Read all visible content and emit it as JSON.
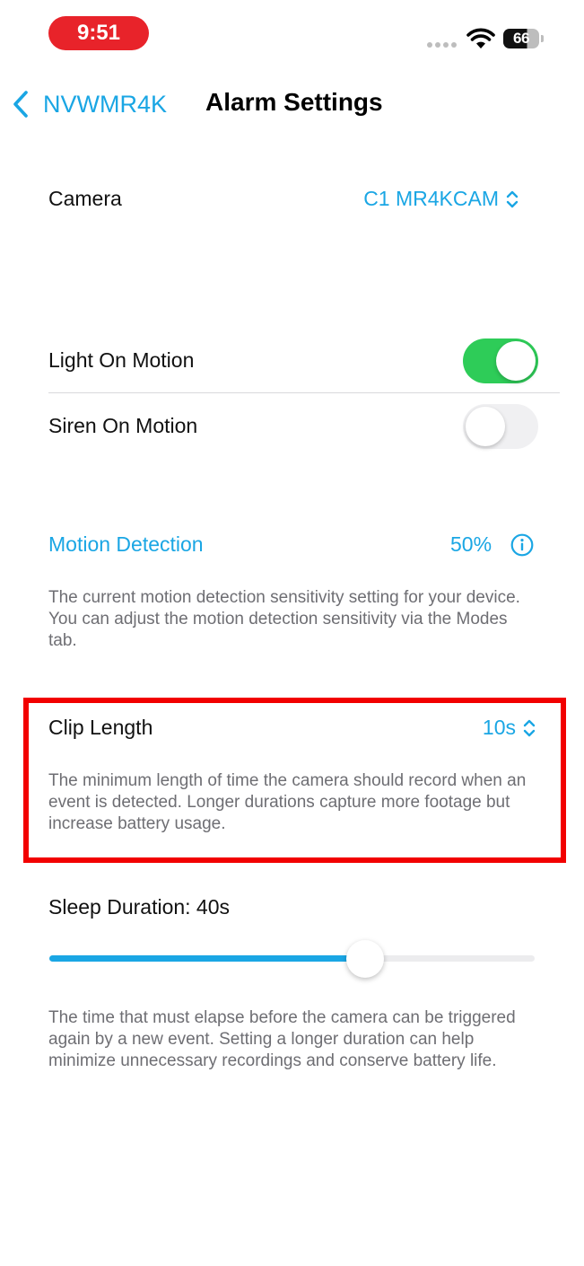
{
  "status_bar": {
    "time": "9:51",
    "battery": "66",
    "battery_level": 0.66,
    "time_pill_color": "#e8232a"
  },
  "nav": {
    "back_label": "NVWMR4K",
    "title": "Alarm Settings"
  },
  "camera": {
    "label": "Camera",
    "value": "C1 MR4KCAM"
  },
  "light_on_motion": {
    "label": "Light On Motion",
    "on": true
  },
  "siren_on_motion": {
    "label": "Siren On Motion",
    "on": false
  },
  "motion_detection": {
    "label": "Motion Detection",
    "value": "50%",
    "description": "The current motion detection sensitivity setting for your device. You can adjust the motion detection sensitivity via the Modes tab."
  },
  "clip_length": {
    "label": "Clip Length",
    "value": "10s",
    "description": "The minimum length of time the camera should record when an event is detected. Longer durations capture more footage but increase battery usage."
  },
  "sleep_duration": {
    "label": "Sleep Duration: 40s",
    "slider_fraction": 0.65,
    "description": "The time that must elapse before the camera can be triggered again by a new event. Setting a longer duration can help minimize unnecessary recordings and conserve battery life."
  },
  "colors": {
    "accent": "#1aa6e4",
    "toggle_on": "#2ecc58",
    "highlight": "#f20000"
  }
}
